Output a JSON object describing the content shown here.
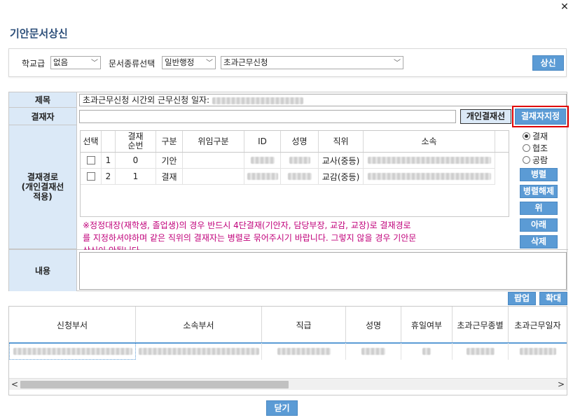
{
  "dialog": {
    "title": "기안문서상신",
    "close_label": "✕"
  },
  "filters": {
    "school_level_label": "학교급",
    "school_level_value": "없음",
    "doc_type_label": "문서종류선택",
    "doc_type_value": "일반행정",
    "doc_subtype_value": "초과근무신청",
    "submit_label": "상신"
  },
  "form": {
    "subject_label": "제목",
    "subject_value": "초과근무신청 시간외 근무신청 일자:",
    "approver_label": "결재자",
    "personal_line_label": "개인결재선",
    "assign_approver_label": "결재자지정",
    "route_label": "결재경로\n(개인결재선\n적용)",
    "content_label": "내용",
    "popup_label": "팝업",
    "zoom_label": "확대",
    "notice": "※정정대장(재학생, 졸업생)의 경우 반드시 4단결재(기안자, 담당부장, 교감, 교장)로 결재경로를 지정하셔야하며 같은 직위의 결재자는 병렬로 묶어주시기 바랍니다. 그렇지 않을 경우 기안문 상신이 안됩니다."
  },
  "approval_table": {
    "headers": [
      "선택",
      "결재\n순번",
      "구분",
      "위임구분",
      "ID",
      "성명",
      "직위",
      "소속"
    ],
    "rows": [
      {
        "no": "1",
        "order": "0",
        "type": "기안",
        "position": "교사(중등)"
      },
      {
        "no": "2",
        "order": "1",
        "type": "결재",
        "position": "교감(중등)"
      }
    ]
  },
  "route_options": {
    "options": [
      "결재",
      "협조",
      "공람"
    ],
    "selected": "결재",
    "buttons": [
      "병렬",
      "병렬해제",
      "위",
      "아래",
      "삭제"
    ]
  },
  "grid": {
    "headers": [
      "신청부서",
      "소속부서",
      "직급",
      "성명",
      "휴일여부",
      "초과근무종별",
      "초과근무일자"
    ]
  },
  "footer": {
    "close_label": "닫기"
  },
  "colors": {
    "accent": "#5b9bd5",
    "header_bg": "#dbe9f7",
    "title_color": "#2d4f7a",
    "highlight_border": "#e00000",
    "notice_color": "#c0007a"
  }
}
